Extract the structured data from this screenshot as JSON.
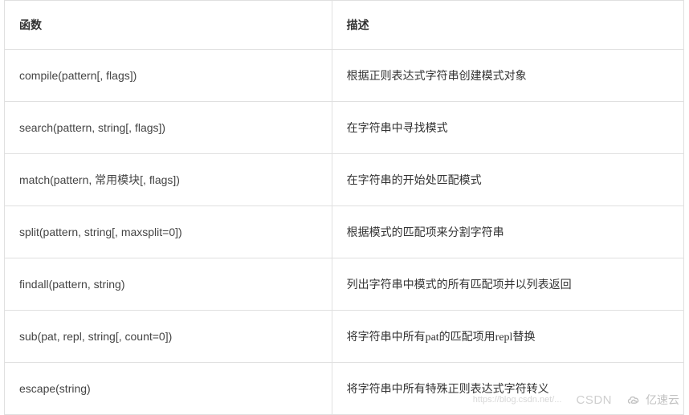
{
  "table": {
    "headers": {
      "func": "函数",
      "desc": "描述"
    },
    "rows": [
      {
        "func": "compile(pattern[, flags])",
        "desc": "根据正则表达式字符串创建模式对象"
      },
      {
        "func": "search(pattern, string[, flags])",
        "desc": "在字符串中寻找模式"
      },
      {
        "func": "match(pattern, 常用模块[, flags])",
        "desc": "在字符串的开始处匹配模式"
      },
      {
        "func": "split(pattern, string[, maxsplit=0])",
        "desc": "根据模式的匹配项来分割字符串"
      },
      {
        "func": "findall(pattern, string)",
        "desc": "列出字符串中模式的所有匹配项并以列表返回"
      },
      {
        "func": "sub(pat, repl, string[, count=0])",
        "desc": "将字符串中所有pat的匹配项用repl替换"
      },
      {
        "func": "escape(string)",
        "desc": "将字符串中所有特殊正则表达式字符转义"
      }
    ]
  },
  "watermarks": {
    "faint": "https://blog.csdn.net/...",
    "csdn": "CSDN",
    "yisu": "亿速云"
  }
}
